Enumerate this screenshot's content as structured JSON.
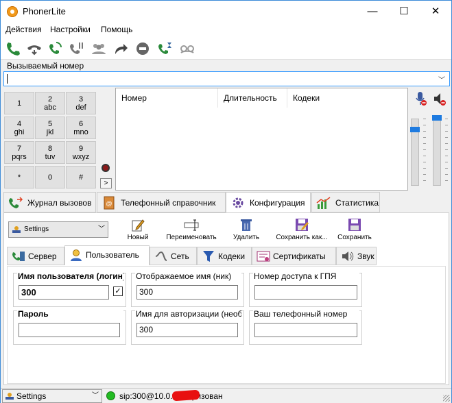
{
  "window": {
    "title": "PhonerLite",
    "minimize": "—",
    "maximize": "☐",
    "close": "✕"
  },
  "menu": [
    "Действия",
    "Настройки",
    "Помощь"
  ],
  "dial": {
    "label": "Вызываемый номер",
    "value": "",
    "arrow": "﹀"
  },
  "keypad": [
    {
      "d": "1",
      "l": ""
    },
    {
      "d": "2",
      "l": "abc"
    },
    {
      "d": "3",
      "l": "def"
    },
    {
      "d": "4",
      "l": "ghi"
    },
    {
      "d": "5",
      "l": "jkl"
    },
    {
      "d": "6",
      "l": "mno"
    },
    {
      "d": "7",
      "l": "pqrs"
    },
    {
      "d": "8",
      "l": "tuv"
    },
    {
      "d": "9",
      "l": "wxyz"
    },
    {
      "d": "*",
      "l": ""
    },
    {
      "d": "0",
      "l": ""
    },
    {
      "d": "#",
      "l": ""
    }
  ],
  "keypad_more": ">",
  "calls_list": {
    "col_number": "Номер",
    "col_duration": "Длительность",
    "col_codecs": "Кодеки"
  },
  "main_tabs": [
    "Журнал вызовов",
    "Телефонный справочник",
    "Конфигурация",
    "Статистика"
  ],
  "profile": {
    "selected": "Settings",
    "arrow": "﹀"
  },
  "profile_buttons": [
    "Новый",
    "Переименовать",
    "Удалить",
    "Сохранить как...",
    "Сохранить"
  ],
  "sub_tabs": [
    "Сервер",
    "Пользователь",
    "Сеть",
    "Кодеки",
    "Сертификаты",
    "Звук"
  ],
  "user": {
    "username_label": "Имя пользователя (логин)",
    "username_value": "300",
    "username_checked": "✓",
    "display_label": "Отображаемое имя (ник)",
    "display_value": "300",
    "gateway_label": "Номер доступа к ГПЯ",
    "gateway_value": "",
    "password_label": "Пароль",
    "password_value": "",
    "auth_label": "Имя для авторизации (необязательно)",
    "auth_value": "300",
    "phone_label": "Ваш телефонный номер",
    "phone_value": ""
  },
  "status": {
    "profile": "Settings",
    "arrow": "﹀",
    "text": "sip:300@10.0.           авторизован"
  },
  "colors": {
    "accent": "#1e7be0",
    "status_ok": "#22bb22",
    "redaction": "#e81010"
  }
}
